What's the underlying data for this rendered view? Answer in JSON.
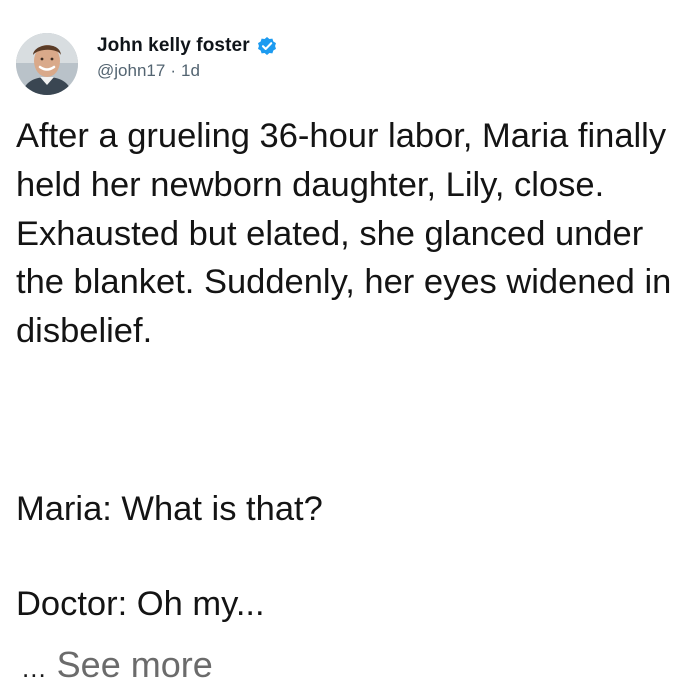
{
  "tweet": {
    "author": {
      "display_name": "John kelly foster",
      "handle": "@john17",
      "separator": "·",
      "age": "1d",
      "verified": true,
      "avatar_icon": "person-avatar-icon",
      "verified_icon": "verified-badge-icon",
      "verified_color": "#1d9bf0"
    },
    "body": {
      "paragraph": "After a grueling 36-hour labor, Maria finally held her newborn daughter, Lily, close. Exhausted but elated, she glanced under the blanket. Suddenly, her eyes widened in disbelief.",
      "line_1": "Maria: What is that?",
      "line_2": "Doctor: Oh my..."
    },
    "see_more": {
      "ellipsis": "...",
      "label": "See more"
    }
  }
}
